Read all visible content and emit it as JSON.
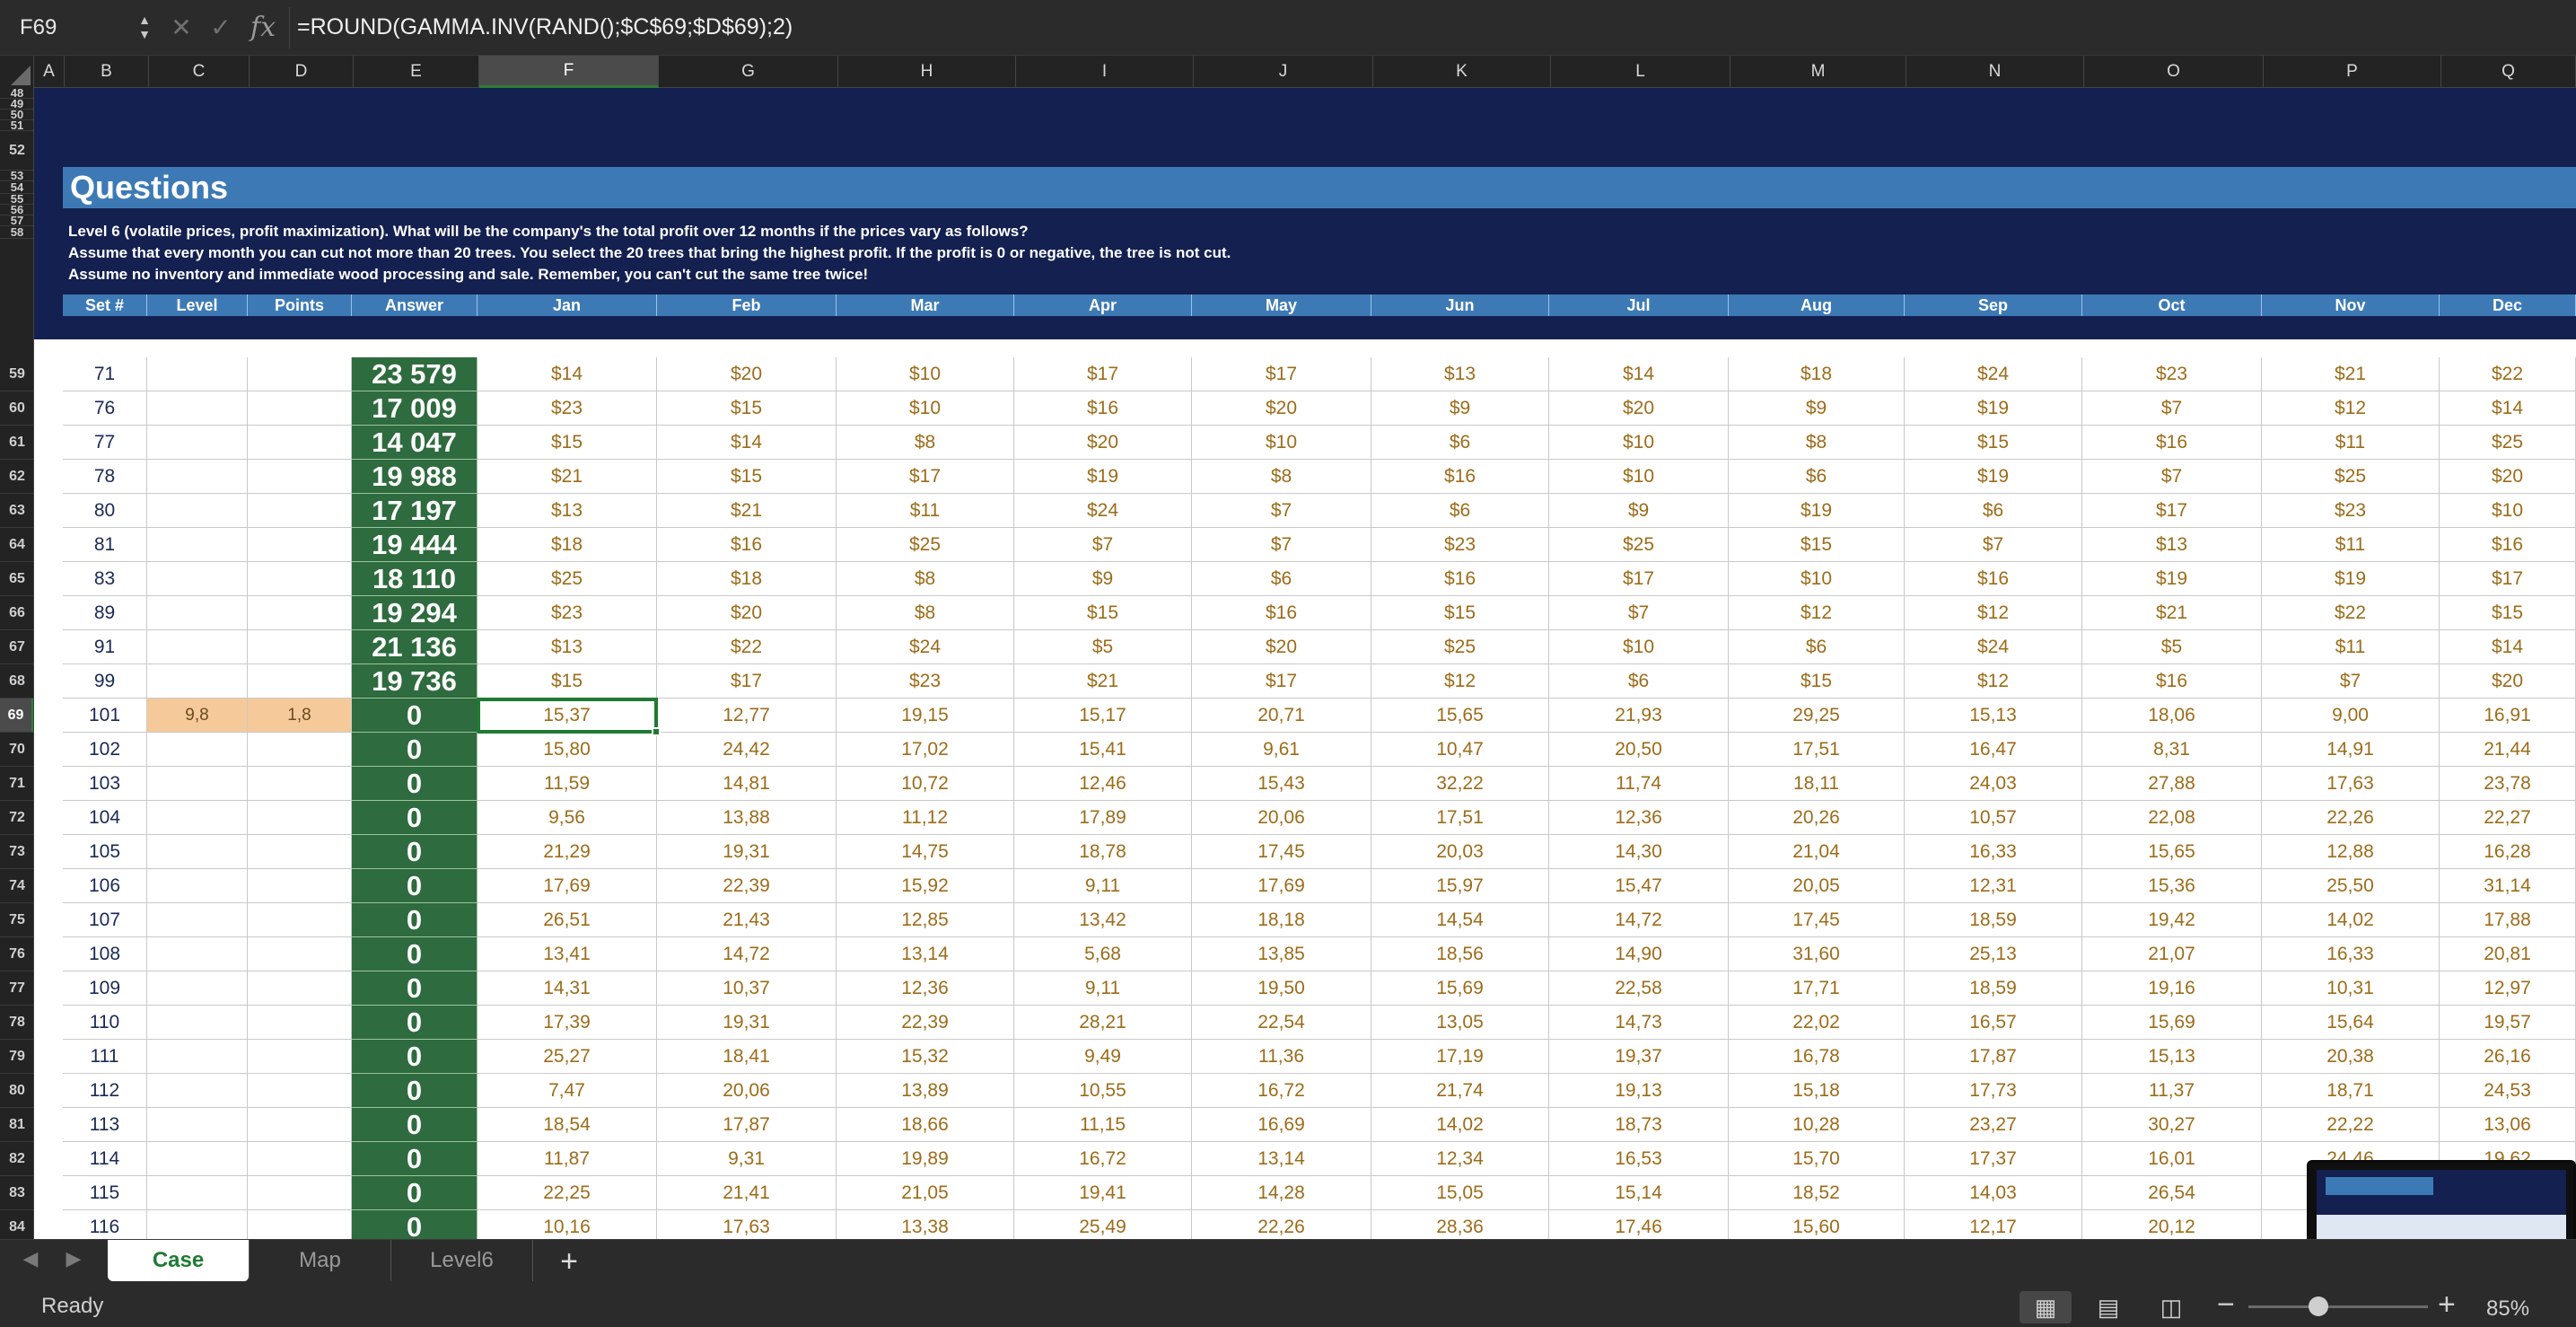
{
  "formula_bar": {
    "name_box": "F69",
    "formula": "=ROUND(GAMMA.INV(RAND();$C$69;$D$69);2)"
  },
  "columns": [
    "A",
    "B",
    "C",
    "D",
    "E",
    "F",
    "G",
    "H",
    "I",
    "J",
    "K",
    "L",
    "M",
    "N",
    "O",
    "P",
    "Q"
  ],
  "active_column": "F",
  "row_numbers": [
    "48",
    "49",
    "50",
    "51",
    "52",
    "53",
    "54",
    "55",
    "56",
    "57",
    "58",
    "59",
    "60",
    "61",
    "62",
    "63",
    "64",
    "65",
    "66",
    "67",
    "68",
    "69",
    "70",
    "71",
    "72",
    "73",
    "74",
    "75",
    "76",
    "77",
    "78",
    "79",
    "80",
    "81",
    "82",
    "83",
    "84"
  ],
  "active_row": "69",
  "questions": {
    "title": "Questions",
    "line1": "Level 6 (volatile prices, profit maximization). What will be the company's the total profit over 12 months if the prices vary as follows?",
    "line2": "Assume that every month you can cut not more than 20 trees. You select the 20 trees that bring the highest profit. If the profit is 0 or negative, the tree is not cut.",
    "line3": "Assume no inventory and immediate wood processing and sale. Remember, you can't cut the same tree twice!"
  },
  "table_headers": [
    "Set #",
    "Level",
    "Points",
    "Answer",
    "Jan",
    "Feb",
    "Mar",
    "Apr",
    "May",
    "Jun",
    "Jul",
    "Aug",
    "Sep",
    "Oct",
    "Nov",
    "Dec"
  ],
  "rows": [
    {
      "set": "71",
      "level": "",
      "points": "",
      "answer": "23 579",
      "prices": [
        "$14",
        "$20",
        "$10",
        "$17",
        "$17",
        "$13",
        "$14",
        "$18",
        "$24",
        "$23",
        "$21",
        "$22"
      ]
    },
    {
      "set": "76",
      "level": "",
      "points": "",
      "answer": "17 009",
      "prices": [
        "$23",
        "$15",
        "$10",
        "$16",
        "$20",
        "$9",
        "$20",
        "$9",
        "$19",
        "$7",
        "$12",
        "$14"
      ]
    },
    {
      "set": "77",
      "level": "",
      "points": "",
      "answer": "14 047",
      "prices": [
        "$15",
        "$14",
        "$8",
        "$20",
        "$10",
        "$6",
        "$10",
        "$8",
        "$15",
        "$16",
        "$11",
        "$25"
      ]
    },
    {
      "set": "78",
      "level": "",
      "points": "",
      "answer": "19 988",
      "prices": [
        "$21",
        "$15",
        "$17",
        "$19",
        "$8",
        "$16",
        "$10",
        "$6",
        "$19",
        "$7",
        "$25",
        "$20"
      ]
    },
    {
      "set": "80",
      "level": "",
      "points": "",
      "answer": "17 197",
      "prices": [
        "$13",
        "$21",
        "$11",
        "$24",
        "$7",
        "$6",
        "$9",
        "$19",
        "$6",
        "$17",
        "$23",
        "$10"
      ]
    },
    {
      "set": "81",
      "level": "",
      "points": "",
      "answer": "19 444",
      "prices": [
        "$18",
        "$16",
        "$25",
        "$7",
        "$7",
        "$23",
        "$25",
        "$15",
        "$7",
        "$13",
        "$11",
        "$16"
      ]
    },
    {
      "set": "83",
      "level": "",
      "points": "",
      "answer": "18 110",
      "prices": [
        "$25",
        "$18",
        "$8",
        "$9",
        "$6",
        "$16",
        "$17",
        "$10",
        "$16",
        "$19",
        "$19",
        "$17"
      ]
    },
    {
      "set": "89",
      "level": "",
      "points": "",
      "answer": "19 294",
      "prices": [
        "$23",
        "$20",
        "$8",
        "$15",
        "$16",
        "$15",
        "$7",
        "$12",
        "$12",
        "$21",
        "$22",
        "$15"
      ]
    },
    {
      "set": "91",
      "level": "",
      "points": "",
      "answer": "21 136",
      "prices": [
        "$13",
        "$22",
        "$24",
        "$5",
        "$20",
        "$25",
        "$10",
        "$6",
        "$24",
        "$5",
        "$11",
        "$14"
      ]
    },
    {
      "set": "99",
      "level": "",
      "points": "",
      "answer": "19 736",
      "prices": [
        "$15",
        "$17",
        "$23",
        "$21",
        "$17",
        "$12",
        "$6",
        "$15",
        "$12",
        "$16",
        "$7",
        "$20"
      ]
    },
    {
      "set": "101",
      "level": "9,8",
      "points": "1,8",
      "answer": "0",
      "prices": [
        "15,37",
        "12,77",
        "19,15",
        "15,17",
        "20,71",
        "15,65",
        "21,93",
        "29,25",
        "15,13",
        "18,06",
        "9,00",
        "16,91"
      ]
    },
    {
      "set": "102",
      "level": "",
      "points": "",
      "answer": "0",
      "prices": [
        "15,80",
        "24,42",
        "17,02",
        "15,41",
        "9,61",
        "10,47",
        "20,50",
        "17,51",
        "16,47",
        "8,31",
        "14,91",
        "21,44"
      ]
    },
    {
      "set": "103",
      "level": "",
      "points": "",
      "answer": "0",
      "prices": [
        "11,59",
        "14,81",
        "10,72",
        "12,46",
        "15,43",
        "32,22",
        "11,74",
        "18,11",
        "24,03",
        "27,88",
        "17,63",
        "23,78"
      ]
    },
    {
      "set": "104",
      "level": "",
      "points": "",
      "answer": "0",
      "prices": [
        "9,56",
        "13,88",
        "11,12",
        "17,89",
        "20,06",
        "17,51",
        "12,36",
        "20,26",
        "10,57",
        "22,08",
        "22,26",
        "22,27"
      ]
    },
    {
      "set": "105",
      "level": "",
      "points": "",
      "answer": "0",
      "prices": [
        "21,29",
        "19,31",
        "14,75",
        "18,78",
        "17,45",
        "20,03",
        "14,30",
        "21,04",
        "16,33",
        "15,65",
        "12,88",
        "16,28"
      ]
    },
    {
      "set": "106",
      "level": "",
      "points": "",
      "answer": "0",
      "prices": [
        "17,69",
        "22,39",
        "15,92",
        "9,11",
        "17,69",
        "15,97",
        "15,47",
        "20,05",
        "12,31",
        "15,36",
        "25,50",
        "31,14"
      ]
    },
    {
      "set": "107",
      "level": "",
      "points": "",
      "answer": "0",
      "prices": [
        "26,51",
        "21,43",
        "12,85",
        "13,42",
        "18,18",
        "14,54",
        "14,72",
        "17,45",
        "18,59",
        "19,42",
        "14,02",
        "17,88"
      ]
    },
    {
      "set": "108",
      "level": "",
      "points": "",
      "answer": "0",
      "prices": [
        "13,41",
        "14,72",
        "13,14",
        "5,68",
        "13,85",
        "18,56",
        "14,90",
        "31,60",
        "25,13",
        "21,07",
        "16,33",
        "20,81"
      ]
    },
    {
      "set": "109",
      "level": "",
      "points": "",
      "answer": "0",
      "prices": [
        "14,31",
        "10,37",
        "12,36",
        "9,11",
        "19,50",
        "15,69",
        "22,58",
        "17,71",
        "18,59",
        "19,16",
        "10,31",
        "12,97"
      ]
    },
    {
      "set": "110",
      "level": "",
      "points": "",
      "answer": "0",
      "prices": [
        "17,39",
        "19,31",
        "22,39",
        "28,21",
        "22,54",
        "13,05",
        "14,73",
        "22,02",
        "16,57",
        "15,69",
        "15,64",
        "19,57"
      ]
    },
    {
      "set": "111",
      "level": "",
      "points": "",
      "answer": "0",
      "prices": [
        "25,27",
        "18,41",
        "15,32",
        "9,49",
        "11,36",
        "17,19",
        "19,37",
        "16,78",
        "17,87",
        "15,13",
        "20,38",
        "26,16"
      ]
    },
    {
      "set": "112",
      "level": "",
      "points": "",
      "answer": "0",
      "prices": [
        "7,47",
        "20,06",
        "13,89",
        "10,55",
        "16,72",
        "21,74",
        "19,13",
        "15,18",
        "17,73",
        "11,37",
        "18,71",
        "24,53"
      ]
    },
    {
      "set": "113",
      "level": "",
      "points": "",
      "answer": "0",
      "prices": [
        "18,54",
        "17,87",
        "18,66",
        "11,15",
        "16,69",
        "14,02",
        "18,73",
        "10,28",
        "23,27",
        "30,27",
        "22,22",
        "13,06"
      ]
    },
    {
      "set": "114",
      "level": "",
      "points": "",
      "answer": "0",
      "prices": [
        "11,87",
        "9,31",
        "19,89",
        "16,72",
        "13,14",
        "12,34",
        "16,53",
        "15,70",
        "17,37",
        "16,01",
        "24,46",
        "19,62"
      ]
    },
    {
      "set": "115",
      "level": "",
      "points": "",
      "answer": "0",
      "prices": [
        "22,25",
        "21,41",
        "21,05",
        "19,41",
        "14,28",
        "15,05",
        "15,14",
        "18,52",
        "14,03",
        "26,54",
        "",
        ""
      ]
    },
    {
      "set": "116",
      "level": "",
      "points": "",
      "answer": "0",
      "prices": [
        "10,16",
        "17,63",
        "13,38",
        "25,49",
        "22,26",
        "28,36",
        "17,46",
        "15,60",
        "12,17",
        "20,12",
        "",
        ""
      ]
    }
  ],
  "sheet_tabs": [
    "Case",
    "Map",
    "Level6"
  ],
  "active_tab": "Case",
  "status": {
    "text": "Ready",
    "zoom": "85%"
  },
  "colors": {
    "header_blue": "#3d7ab5",
    "dark_navy": "#132050",
    "answer_green": "#2e6b3e",
    "accent_green": "#1f7a33",
    "price_brown": "#9c6c1a"
  }
}
